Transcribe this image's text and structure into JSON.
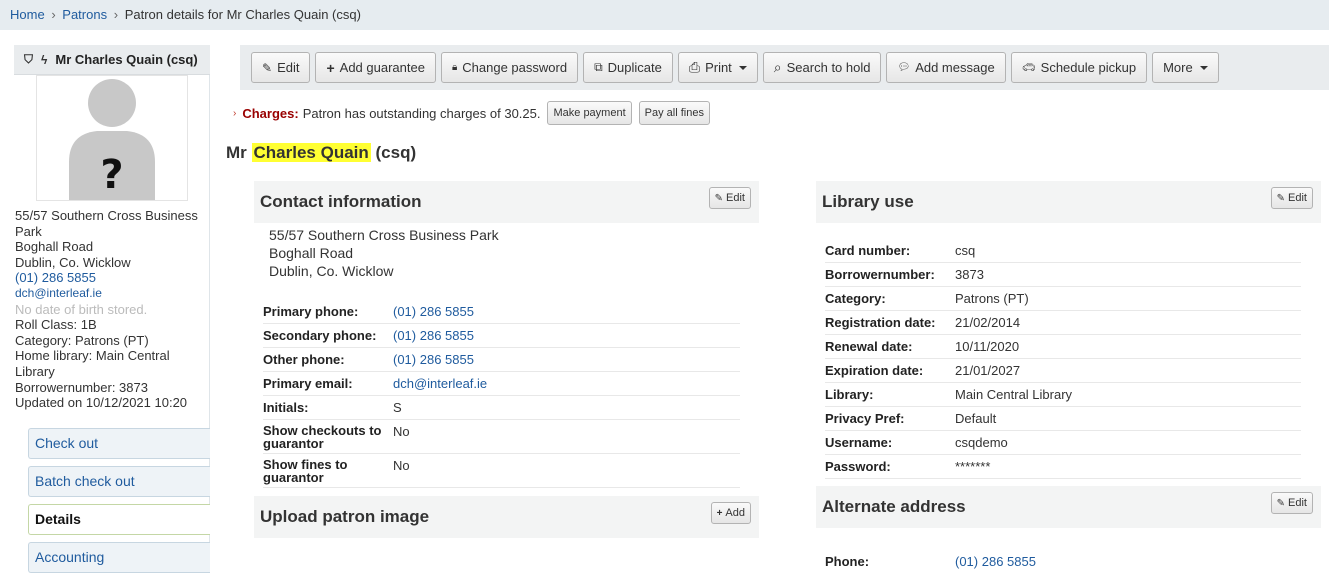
{
  "breadcrumb": {
    "home": "Home",
    "sep": "›",
    "patrons": "Patrons",
    "current": "Patron details for Mr Charles Quain (csq)"
  },
  "sidebar": {
    "name": "Mr Charles Quain (csq)",
    "icons": [
      "shield-icon",
      "flash-icon"
    ],
    "address_lines": [
      "55/57 Southern Cross Business Park",
      "Boghall Road",
      "Dublin, Co. Wicklow"
    ],
    "phone": "(01) 286 5855",
    "email": "dch@interleaf.ie",
    "dob": "No date of birth stored.",
    "roll_class": "Roll Class: 1B",
    "category": "Category: Patrons (PT)",
    "home_library": "Home library: Main Central Library",
    "borrowernumber": "Borrowernumber: 3873",
    "updated": "Updated on 10/12/2021 10:20"
  },
  "nav": [
    {
      "label": "Check out",
      "active": false
    },
    {
      "label": "Batch check out",
      "active": false
    },
    {
      "label": "Details",
      "active": true
    },
    {
      "label": "Accounting",
      "active": false
    }
  ],
  "toolbar": [
    {
      "label": "Edit",
      "icon": "pencil-icon",
      "glyph": "✎",
      "dropdown": false
    },
    {
      "label": "Add guarantee",
      "icon": "plus-icon",
      "glyph": "+",
      "dropdown": false
    },
    {
      "label": "Change password",
      "icon": "lock-icon",
      "glyph": "🔒︎",
      "dropdown": false
    },
    {
      "label": "Duplicate",
      "icon": "copy-icon",
      "glyph": "⧉",
      "dropdown": false
    },
    {
      "label": "Print",
      "icon": "print-icon",
      "glyph": "⎙",
      "dropdown": true
    },
    {
      "label": "Search to hold",
      "icon": "search-icon",
      "glyph": "⌕",
      "dropdown": false
    },
    {
      "label": "Add message",
      "icon": "comment-icon",
      "glyph": "💬︎",
      "dropdown": false
    },
    {
      "label": "Schedule pickup",
      "icon": "car-icon",
      "glyph": "🚗︎",
      "dropdown": false
    },
    {
      "label": "More",
      "icon": "",
      "glyph": "",
      "dropdown": true
    }
  ],
  "charges": {
    "label": "Charges:",
    "text": "Patron has outstanding charges of 30.25.",
    "make_payment": "Make payment",
    "pay_all": "Pay all fines"
  },
  "title": {
    "prefix": "Mr",
    "highlight": "Charles Quain",
    "suffix": "(csq)"
  },
  "contact": {
    "heading": "Contact information",
    "edit": "Edit",
    "address_lines": [
      "55/57 Southern Cross Business Park",
      "Boghall Road",
      "Dublin, Co. Wicklow"
    ],
    "rows": [
      {
        "k": "Primary phone:",
        "v": "(01) 286 5855",
        "link": true
      },
      {
        "k": "Secondary phone:",
        "v": "(01) 286 5855",
        "link": true
      },
      {
        "k": "Other phone:",
        "v": "(01) 286 5855",
        "link": true
      },
      {
        "k": "Primary email:",
        "v": "dch@interleaf.ie",
        "link": true
      },
      {
        "k": "Initials:",
        "v": "S",
        "link": false
      },
      {
        "k": "Show checkouts to guarantor",
        "v": "No",
        "link": false,
        "two": true
      },
      {
        "k": "Show fines to guarantor",
        "v": "No",
        "link": false,
        "two": true
      }
    ]
  },
  "upload": {
    "heading": "Upload patron image",
    "add": "Add"
  },
  "library_use": {
    "heading": "Library use",
    "edit": "Edit",
    "rows": [
      {
        "k": "Card number:",
        "v": "csq"
      },
      {
        "k": "Borrowernumber:",
        "v": "3873"
      },
      {
        "k": "Category:",
        "v": "Patrons (PT)"
      },
      {
        "k": "Registration date:",
        "v": "21/02/2014"
      },
      {
        "k": "Renewal date:",
        "v": "10/11/2020"
      },
      {
        "k": "Expiration date:",
        "v": "21/01/2027"
      },
      {
        "k": "Library:",
        "v": "Main Central Library"
      },
      {
        "k": "Privacy Pref:",
        "v": "Default"
      },
      {
        "k": "Username:",
        "v": "csqdemo"
      },
      {
        "k": "Password:",
        "v": "*******"
      }
    ]
  },
  "alternate": {
    "heading": "Alternate address",
    "edit": "Edit",
    "rows": [
      {
        "k": "Phone:",
        "v": "(01) 286 5855",
        "link": true
      }
    ]
  }
}
